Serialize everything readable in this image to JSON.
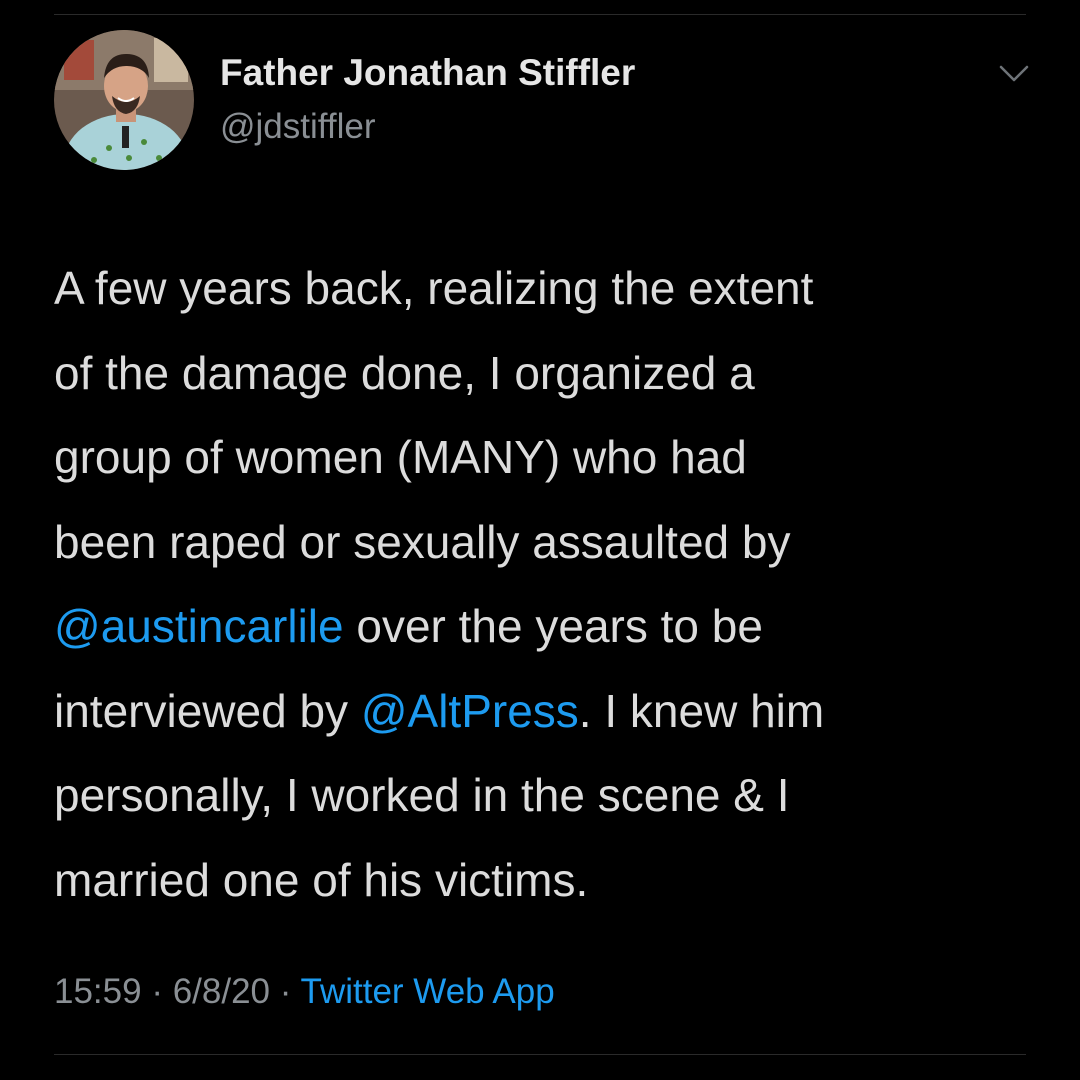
{
  "tweet": {
    "author": {
      "display_name": "Father Jonathan Stiffler",
      "handle": "@jdstiffler"
    },
    "menu_icon": "chevron-down-icon",
    "body_lines": [
      {
        "segments": [
          {
            "text": "A few years back, realizing the extent"
          }
        ]
      },
      {
        "segments": [
          {
            "text": "of the damage done, I organized a"
          }
        ]
      },
      {
        "segments": [
          {
            "text": "group of women (MANY) who had"
          }
        ]
      },
      {
        "segments": [
          {
            "text": "been raped or sexually assaulted by"
          }
        ]
      },
      {
        "segments": [
          {
            "text": "@austincarlile"
          },
          {
            "text": " over the years to be"
          }
        ]
      },
      {
        "segments": [
          {
            "text": "interviewed by "
          },
          {
            "text": "@AltPress"
          },
          {
            "text": ". I knew him"
          }
        ]
      },
      {
        "segments": [
          {
            "text": "personally, I worked in the scene & I"
          }
        ]
      },
      {
        "segments": [
          {
            "text": "married one of his victims."
          }
        ]
      }
    ],
    "meta": {
      "time": "15:59",
      "separator": " · ",
      "date": "6/8/20",
      "source": "Twitter Web App"
    }
  },
  "colors": {
    "background": "#000000",
    "text": "#dcdcdc",
    "secondary_text": "#8a8f94",
    "link": "#1d9bf0"
  }
}
